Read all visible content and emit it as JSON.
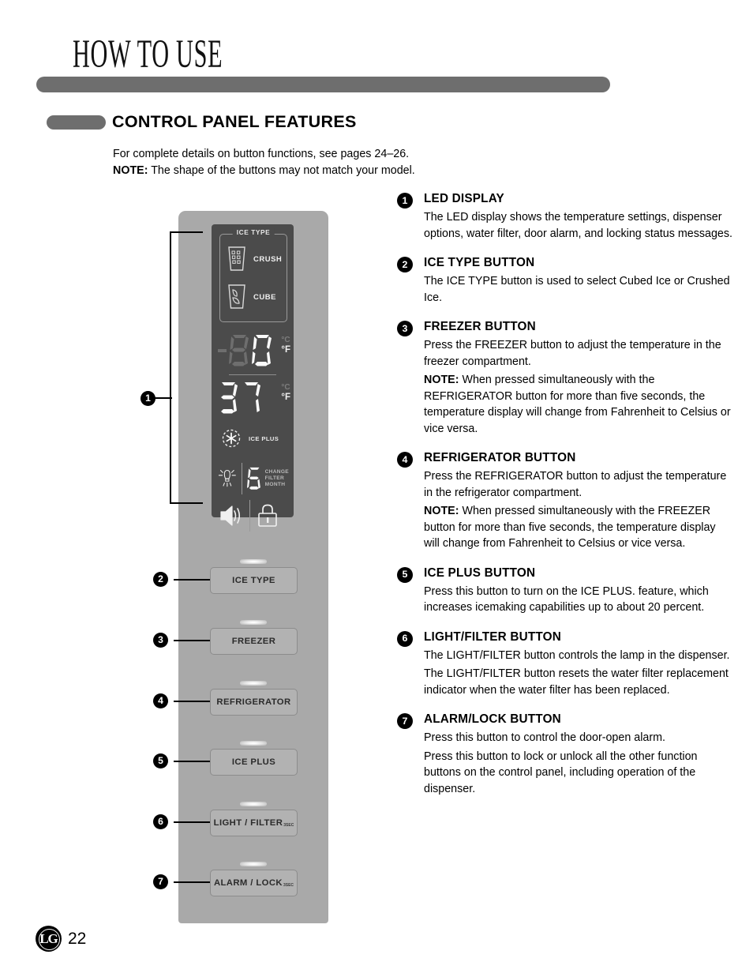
{
  "header": {
    "chapter_title": "HOW TO USE",
    "section_pill_icon": "pill-marker",
    "section_title": "CONTROL PANEL FEATURES"
  },
  "intro": {
    "line1": "For complete details on button functions, see pages 24–26.",
    "note_label": "NOTE:",
    "note_text": " The shape of the buttons may not match your model."
  },
  "diagram": {
    "led_display": {
      "ice_type_label": "ICE TYPE",
      "ice_options": [
        {
          "icon": "crushed-ice-glass-icon",
          "label": "CRUSH"
        },
        {
          "icon": "cubed-ice-glass-icon",
          "label": "CUBE"
        }
      ],
      "freezer_temp": {
        "sign": "-",
        "digits": "0",
        "dim_digit": "8",
        "unit_celsius": "°C",
        "unit_fahrenheit": "°F"
      },
      "fridge_temp": {
        "digits": "37",
        "unit_celsius": "°C",
        "unit_fahrenheit": "°F"
      },
      "ice_plus": {
        "icon": "snowflake-ice-plus-icon",
        "label": "ICE PLUS"
      },
      "lamp_icon": "light-bulb-icon",
      "filter": {
        "digit": "6",
        "line1": "CHANGE",
        "line2": "FILTER",
        "line3": "MONTH"
      },
      "alarm_icon": "speaker-alarm-icon",
      "lock_icon": "padlock-icon"
    },
    "buttons": [
      {
        "callout": "2",
        "label": "ICE TYPE",
        "sub": ""
      },
      {
        "callout": "3",
        "label": "FREEZER",
        "sub": ""
      },
      {
        "callout": "4",
        "label": "REFRIGERATOR",
        "sub": ""
      },
      {
        "callout": "5",
        "label": "ICE PLUS",
        "sub": ""
      },
      {
        "callout": "6",
        "label": "LIGHT / FILTER",
        "sub": "3SEC"
      },
      {
        "callout": "7",
        "label": "ALARM / LOCK",
        "sub": "3SEC"
      }
    ],
    "display_callout": "1"
  },
  "descriptions": [
    {
      "num": "1",
      "title": "LED DISPLAY",
      "paragraphs": [
        {
          "text": "The LED display shows the temperature settings, dispenser options, water filter, door alarm, and locking status messages."
        }
      ]
    },
    {
      "num": "2",
      "title": "ICE TYPE BUTTON",
      "paragraphs": [
        {
          "text": "The ICE TYPE button is used to select Cubed Ice or Crushed Ice."
        }
      ]
    },
    {
      "num": "3",
      "title": "FREEZER BUTTON",
      "paragraphs": [
        {
          "text": "Press the FREEZER button to adjust the temperature in the freezer compartment."
        },
        {
          "bold": "NOTE:",
          "text": " When pressed simultaneously with the REFRIGERATOR button for more than five seconds, the temperature display will change from Fahrenheit to Celsius or vice versa."
        }
      ]
    },
    {
      "num": "4",
      "title": "REFRIGERATOR BUTTON",
      "paragraphs": [
        {
          "text": "Press the REFRIGERATOR button to adjust the temperature in the refrigerator compartment."
        },
        {
          "bold": "NOTE:",
          "text": " When pressed simultaneously with the FREEZER button for more than five seconds, the temperature display will change from Fahrenheit to Celsius or vice versa."
        }
      ]
    },
    {
      "num": "5",
      "title": "ICE PLUS BUTTON",
      "paragraphs": [
        {
          "text": "Press this button to turn on the ICE PLUS. feature, which increases icemaking capabilities up to about 20 percent."
        }
      ]
    },
    {
      "num": "6",
      "title": "LIGHT/FILTER BUTTON",
      "paragraphs": [
        {
          "text": "The LIGHT/FILTER button controls the lamp in the dispenser."
        },
        {
          "text": "The LIGHT/FILTER button resets the water filter replacement indicator when the water filter has been replaced."
        }
      ]
    },
    {
      "num": "7",
      "title": "ALARM/LOCK BUTTON",
      "paragraphs": [
        {
          "text": "Press this button to control the door-open alarm."
        },
        {
          "text": "Press this button to lock or unlock all the other function buttons on the control panel, including operation of the dispenser."
        }
      ]
    }
  ],
  "footer": {
    "logo": "lg-logo",
    "logo_text": "LG",
    "page_number": "22"
  },
  "colors": {
    "rule_gray": "#6e6e6e",
    "panel_gray": "#a9a9a9",
    "display_dark": "#4b4b4b",
    "button_gray": "#b2b2b2"
  }
}
